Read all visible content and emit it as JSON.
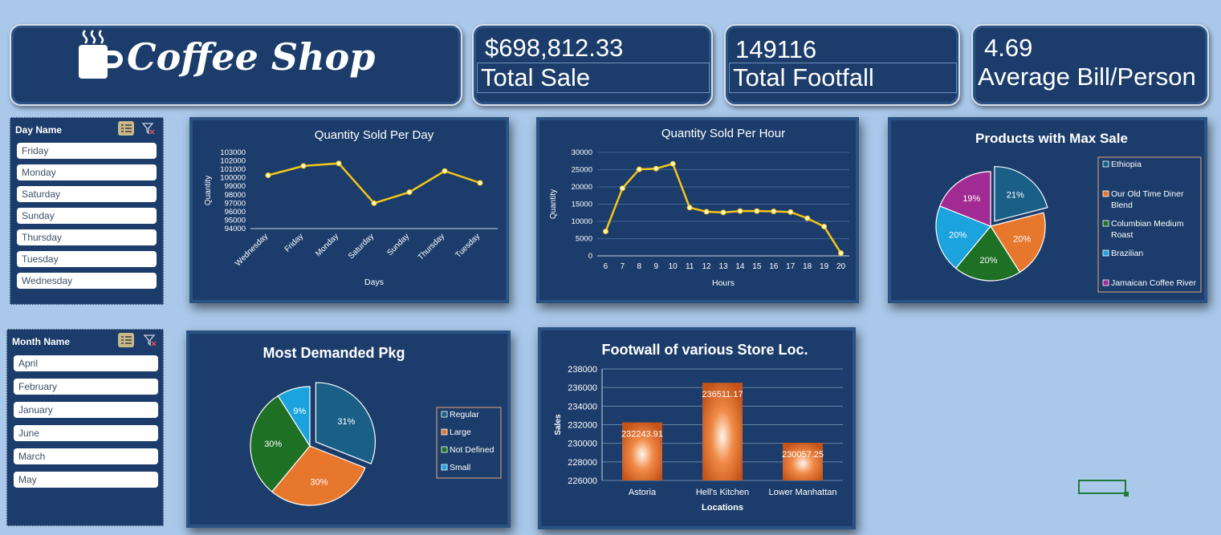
{
  "header": {
    "title": "Coffee Shop",
    "logo_icon": "coffee-cup-icon"
  },
  "kpis": [
    {
      "value": "$698,812.33",
      "label": "Total Sale"
    },
    {
      "value": "149116",
      "label": "Total Footfall"
    },
    {
      "value": "4.69",
      "label": "Average Bill/Person"
    }
  ],
  "slicers": {
    "day": {
      "title": "Day Name",
      "items": [
        "Friday",
        "Monday",
        "Saturday",
        "Sunday",
        "Thursday",
        "Tuesday",
        "Wednesday"
      ]
    },
    "month": {
      "title": "Month Name",
      "items": [
        "April",
        "February",
        "January",
        "June",
        "March",
        "May"
      ]
    }
  },
  "colors": {
    "background": "#a9c8ea",
    "panel": "#1c3d6b",
    "line": "#f5c518",
    "bar": "#e8772e"
  },
  "chart_data": [
    {
      "type": "line",
      "title": "Quantity Sold Per Day",
      "xlabel": "Days",
      "ylabel": "Quantity",
      "categories": [
        "Wednesday",
        "Friday",
        "Monday",
        "Saturday",
        "Sunday",
        "Thursday",
        "Tuesday"
      ],
      "values": [
        100300,
        101400,
        101700,
        97000,
        98300,
        100800,
        99400
      ],
      "yticks": [
        "103000",
        "102000",
        "101000",
        "100000",
        "99000",
        "98000",
        "97000",
        "96000",
        "95000",
        "94000"
      ],
      "ylim": [
        94000,
        103000
      ]
    },
    {
      "type": "line",
      "title": "Quantity Sold Per Hour",
      "xlabel": "Hours",
      "ylabel": "Quantity",
      "categories": [
        "6",
        "7",
        "8",
        "9",
        "10",
        "11",
        "12",
        "13",
        "14",
        "15",
        "16",
        "17",
        "18",
        "19",
        "20"
      ],
      "values": [
        7100,
        19600,
        25100,
        25300,
        26700,
        14000,
        12800,
        12600,
        13000,
        13000,
        12900,
        12700,
        10900,
        8500,
        800
      ],
      "yticks": [
        "30000",
        "25000",
        "20000",
        "15000",
        "10000",
        "5000",
        "0"
      ],
      "ylim": [
        0,
        30000
      ]
    },
    {
      "type": "pie",
      "title": "Products  with Max Sale",
      "labels": [
        "Ethiopia",
        "Our Old Time Diner Blend",
        "Columbian Medium Roast",
        "Brazilian",
        "Jamaican Coffee River"
      ],
      "values": [
        21,
        20,
        20,
        20,
        19
      ],
      "value_labels": [
        "21%",
        "20%",
        "20%",
        "20%",
        "19%"
      ],
      "colors": [
        "#1a5f86",
        "#e8772e",
        "#1e7025",
        "#1aa3dd",
        "#a22b93"
      ]
    },
    {
      "type": "pie",
      "title": "Most Demanded Pkg",
      "labels": [
        "Regular",
        "Large",
        "Not Defined",
        "Small"
      ],
      "values": [
        31,
        30,
        30,
        9
      ],
      "value_labels": [
        "31%",
        "30%",
        "30%",
        "9%"
      ],
      "colors": [
        "#1a5f86",
        "#e8772e",
        "#1e7025",
        "#1aa3dd"
      ]
    },
    {
      "type": "bar",
      "title": "Footwall of various Store Loc.",
      "xlabel": "Locations",
      "ylabel": "Sales",
      "categories": [
        "Astoria",
        "Hell's Kitchen",
        "Lower Manhattan"
      ],
      "values": [
        232243.91,
        236511.17,
        230057.25
      ],
      "value_labels": [
        "232243.91",
        "236511.17",
        "230057.25"
      ],
      "yticks": [
        "238000",
        "236000",
        "234000",
        "232000",
        "230000",
        "228000",
        "226000"
      ],
      "ylim": [
        226000,
        238000
      ]
    }
  ]
}
